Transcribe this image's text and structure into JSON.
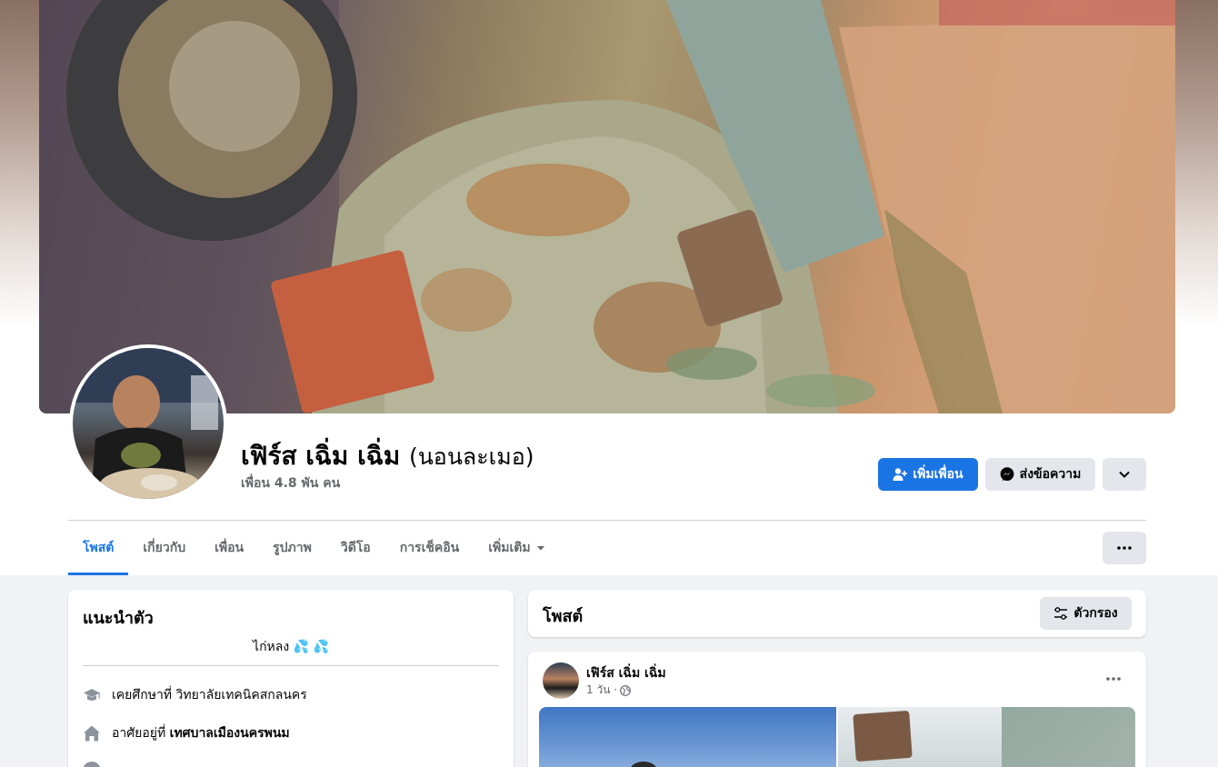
{
  "profile": {
    "name": "เฟิร์ส เฉิ่ม เฉิ่ม",
    "alternate_name": "(นอนละเมอ)",
    "friends_count": "เพื่อน 4.8 พัน คน"
  },
  "actions": {
    "add_friend": "เพิ่มเพื่อน",
    "message": "ส่งข้อความ"
  },
  "tabs": [
    {
      "label": "โพสต์",
      "active": true
    },
    {
      "label": "เกี่ยวกับ"
    },
    {
      "label": "เพื่อน"
    },
    {
      "label": "รูปภาพ"
    },
    {
      "label": "วิดีโอ"
    },
    {
      "label": "การเช็คอิน"
    },
    {
      "label": "เพิ่มเติม"
    }
  ],
  "intro": {
    "title": "แนะนำตัว",
    "bio": "ไก่หลง 💦 💦",
    "items": [
      {
        "icon": "graduation-cap-icon",
        "prefix": "เคยศึกษาที่ วิทยาลัยเทคนิคสกลนคร",
        "bold": ""
      },
      {
        "icon": "home-icon",
        "prefix": "อาศัยอยู่ที่ ",
        "bold": "เทศบาลเมืองนครพนม"
      }
    ]
  },
  "posts": {
    "title": "โพสต์",
    "filter_label": "ตัวกรอง",
    "first_post": {
      "author": "เฟิร์ส เฉิ่ม เฉิ่ม",
      "time": "1 วัน ·"
    }
  },
  "colors": {
    "accent": "#1b74e4",
    "background": "#f0f2f5",
    "secondary_button": "#e4e6eb",
    "muted_text": "#65676b"
  }
}
